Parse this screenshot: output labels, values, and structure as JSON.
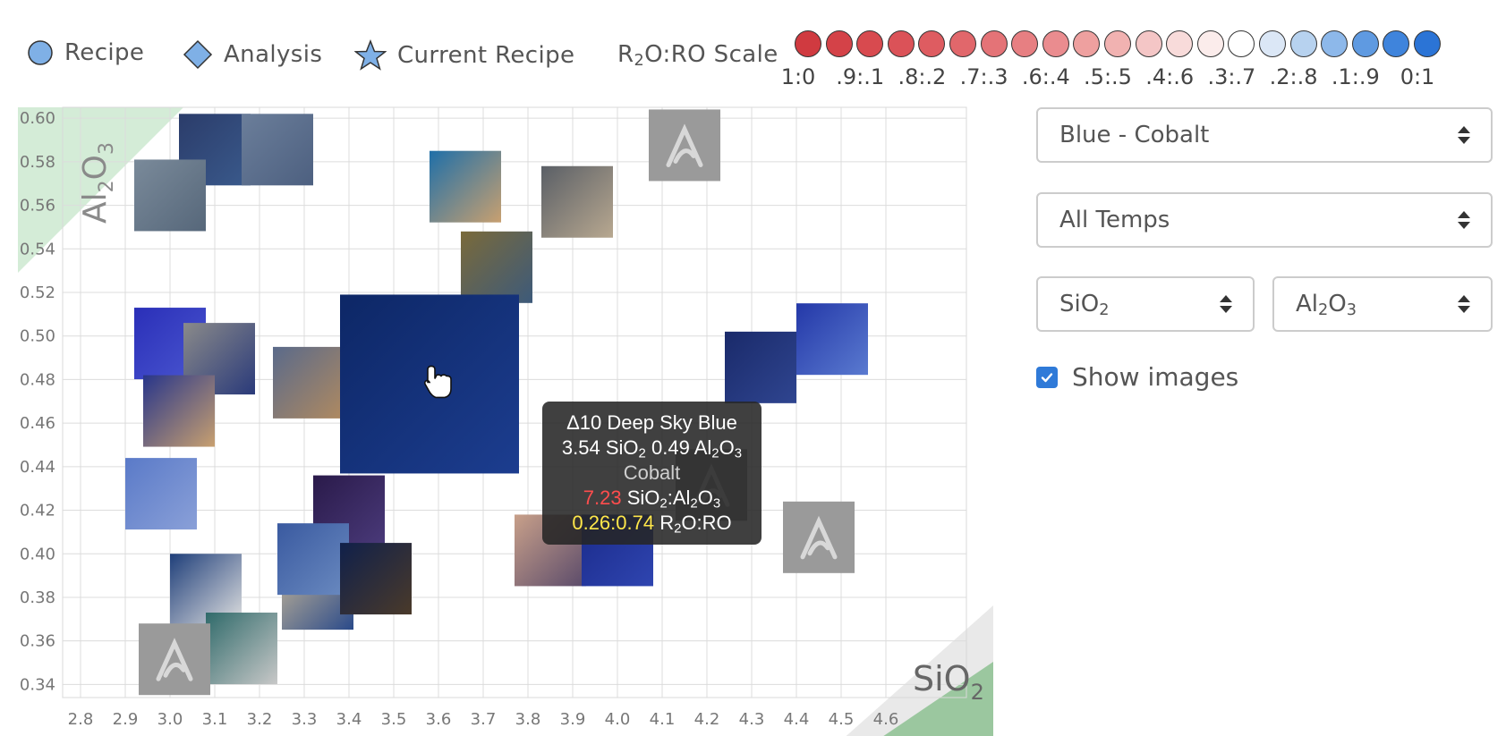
{
  "legend": {
    "recipe_label": "Recipe",
    "analysis_label": "Analysis",
    "current_recipe_label": "Current Recipe",
    "scale_title_prefix": "R",
    "scale_title_sub": "2",
    "scale_title_suffix": "O:RO Scale",
    "scale_colors": [
      "#d03a40",
      "#d44248",
      "#d84a4f",
      "#db5258",
      "#de5c61",
      "#e1676b",
      "#e47377",
      "#e77f82",
      "#ea8c8f",
      "#eea09f",
      "#f1b2b1",
      "#f4c6c6",
      "#f8dbda",
      "#fbeceb",
      "#ffffff",
      "#dbe7f6",
      "#b7d2ef",
      "#8db8ea",
      "#5f9ae1",
      "#3f84dc",
      "#2b74d6"
    ],
    "scale_labels": [
      "1:0",
      ".9:.1",
      ".8:.2",
      ".7:.3",
      ".6:.4",
      ".5:.5",
      ".4:.6",
      ".3:.7",
      ".2:.8",
      ".1:.9",
      "0:1"
    ]
  },
  "chart": {
    "x_ticks": [
      "2.8",
      "2.9",
      "3.0",
      "3.1",
      "3.2",
      "3.3",
      "3.4",
      "3.5",
      "3.6",
      "3.7",
      "3.8",
      "3.9",
      "4.0",
      "4.1",
      "4.2",
      "4.3",
      "4.4",
      "4.5",
      "4.6"
    ],
    "y_ticks": [
      "0.60",
      "0.58",
      "0.56",
      "0.54",
      "0.52",
      "0.50",
      "0.48",
      "0.46",
      "0.44",
      "0.42",
      "0.40",
      "0.38",
      "0.36",
      "0.34"
    ],
    "xlim": [
      2.76,
      4.78
    ],
    "ylim": [
      0.334,
      0.605
    ],
    "x_axis_name": "SiO",
    "x_axis_sub": "2",
    "y_axis_name": "Al",
    "y_axis_sub1": "2",
    "y_axis_mid": "O",
    "y_axis_sub2": "3",
    "thumbnails": [
      {
        "name": "recipe-thumb-blue-stripes",
        "x": 3.02,
        "y": 0.602,
        "colors": [
          "#2b3c6a",
          "#3a5a8c"
        ]
      },
      {
        "name": "recipe-thumb-grey-stripes",
        "x": 3.16,
        "y": 0.602,
        "colors": [
          "#6b7e9a",
          "#4d6080"
        ]
      },
      {
        "name": "recipe-thumb-vase",
        "x": 2.92,
        "y": 0.581,
        "colors": [
          "#7a8a9a",
          "#56677a"
        ]
      },
      {
        "name": "recipe-thumb-bowl",
        "x": 3.58,
        "y": 0.585,
        "colors": [
          "#1f6fa8",
          "#c8a070"
        ]
      },
      {
        "name": "recipe-thumb-mugs",
        "x": 3.83,
        "y": 0.578,
        "colors": [
          "#5a5f66",
          "#b8a890"
        ]
      },
      {
        "name": "recipe-thumb-goblets",
        "x": 3.65,
        "y": 0.548,
        "colors": [
          "#7a6a3a",
          "#3d5a7a"
        ]
      },
      {
        "name": "recipe-thumb-tile-cobalt",
        "x": 2.92,
        "y": 0.513,
        "colors": [
          "#2a2fb8",
          "#4a56d0"
        ]
      },
      {
        "name": "recipe-thumb-mug-white",
        "x": 3.03,
        "y": 0.506,
        "colors": [
          "#8a8a8a",
          "#2a3a7a"
        ]
      },
      {
        "name": "recipe-thumb-stack",
        "x": 3.23,
        "y": 0.495,
        "colors": [
          "#5a6a8a",
          "#b08a60"
        ]
      },
      {
        "name": "recipe-thumb-bottle",
        "x": 2.94,
        "y": 0.482,
        "colors": [
          "#27358a",
          "#c8a070"
        ]
      },
      {
        "name": "recipe-thumb-cobalt-stack",
        "x": 4.4,
        "y": 0.515,
        "colors": [
          "#2438a8",
          "#5a7ad0"
        ]
      },
      {
        "name": "recipe-thumb-dark-tile",
        "x": 4.24,
        "y": 0.502,
        "colors": [
          "#1a2a6a",
          "#2f4590"
        ]
      },
      {
        "name": "recipe-thumb-shard-blue",
        "x": 2.9,
        "y": 0.444,
        "colors": [
          "#5a7ac8",
          "#8aa0d8"
        ]
      },
      {
        "name": "recipe-thumb-dark-tile-2",
        "x": 3.32,
        "y": 0.436,
        "colors": [
          "#2a1a4a",
          "#4a3a7a"
        ]
      },
      {
        "name": "recipe-thumb-mug-blue",
        "x": 3.0,
        "y": 0.4,
        "colors": [
          "#1f3f7a",
          "#e0e0e0"
        ]
      },
      {
        "name": "recipe-thumb-test-tile",
        "x": 3.25,
        "y": 0.398,
        "colors": [
          "#c8b898",
          "#2a4a8a"
        ]
      },
      {
        "name": "recipe-thumb-blue-slab",
        "x": 3.24,
        "y": 0.414,
        "colors": [
          "#3a5aa0",
          "#6a8ac0"
        ]
      },
      {
        "name": "recipe-thumb-pot-dark",
        "x": 3.38,
        "y": 0.405,
        "colors": [
          "#10204a",
          "#4a3a2a"
        ]
      },
      {
        "name": "recipe-thumb-rust-shard",
        "x": 3.77,
        "y": 0.418,
        "colors": [
          "#c8a08a",
          "#5a4a6a"
        ]
      },
      {
        "name": "recipe-thumb-cobalt-box",
        "x": 3.92,
        "y": 0.418,
        "colors": [
          "#1a2a8a",
          "#2f45b0"
        ]
      },
      {
        "name": "recipe-thumb-green-bowls",
        "x": 3.08,
        "y": 0.373,
        "colors": [
          "#2f6a6a",
          "#c8c8c8"
        ]
      }
    ],
    "placeholders": [
      {
        "name": "recipe-thumb-placeholder-top",
        "x": 4.07,
        "y": 0.604
      },
      {
        "name": "recipe-thumb-placeholder-mid",
        "x": 4.13,
        "y": 0.448
      },
      {
        "name": "recipe-thumb-placeholder-right",
        "x": 4.37,
        "y": 0.424
      },
      {
        "name": "recipe-thumb-placeholder-bottom",
        "x": 2.93,
        "y": 0.368
      }
    ],
    "current": {
      "name": "current-recipe-image",
      "x": 3.38,
      "y": 0.519,
      "colors": [
        "#0d2766",
        "#1c3d8f"
      ]
    }
  },
  "tooltip": {
    "title": "Δ10 Deep Sky Blue",
    "sio2_value": "3.54",
    "al2o3_value": "0.49",
    "colorant": "Cobalt",
    "ratio_value": "7.23",
    "r2o_value": "0.26:0.74"
  },
  "controls": {
    "glaze_color": "Blue - Cobalt",
    "temps": "All Temps",
    "x_axis_select_main": "SiO",
    "x_axis_select_sub": "2",
    "y_axis_select_main": "Al",
    "y_axis_select_sub1": "2",
    "y_axis_select_mid": "O",
    "y_axis_select_sub2": "3",
    "show_images_label": "Show images",
    "show_images_checked": true
  }
}
